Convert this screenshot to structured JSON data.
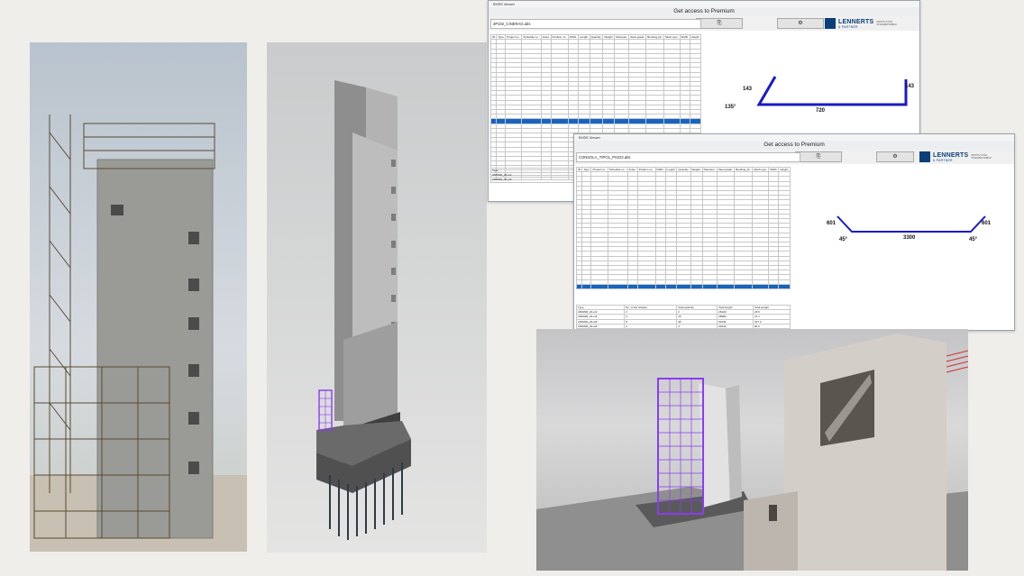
{
  "window1": {
    "title": "BVBS Viewer",
    "premium": "Get access to Premium",
    "file": "3P102_CINERAG.abs",
    "bottom_header": "Type",
    "bottom_rows": [
      "A500NR_20+12",
      "A500NR_20+16"
    ],
    "dims": {
      "left": "143",
      "angle": "135°",
      "bottom": "720",
      "right": "143"
    },
    "columns": [
      "ID",
      "Type",
      "Project no.",
      "Schedule no.",
      "Index",
      "Position no.",
      "DWG",
      "Length",
      "Quantity",
      "Weight",
      "Diameter",
      "Steel grade",
      "Bending pin",
      "Mesh type",
      "Width",
      "Height"
    ]
  },
  "window2": {
    "title": "BVBS Viewer",
    "premium": "Get access to Premium",
    "file": "CONSOLA_TIPO1_PISO3.abs",
    "dims": {
      "left": "601",
      "bottom": "3300",
      "right": "601",
      "angle_left": "45°",
      "angle_right": "45°"
    },
    "columns": [
      "ID",
      "Type",
      "Project no.",
      "Schedule no.",
      "Index",
      "Position no.",
      "DWG",
      "Length",
      "Quantity",
      "Weight",
      "Diameter",
      "Steel grade",
      "Bending pin",
      "Mesh type",
      "Width",
      "Height"
    ],
    "summary_columns": [
      "Type",
      "No. of bar shapes",
      "Total quantity",
      "Total length",
      "Total weight"
    ],
    "summary_rows": [
      [
        "A500NR_20+12",
        "2",
        "2",
        "26440",
        "23.5"
      ],
      [
        "A500NR_20+16",
        "4",
        "16",
        "28980",
        "47.1"
      ],
      [
        "A500NR_20+20",
        "8",
        "48",
        "92134",
        "227.3"
      ],
      [
        "A500NR_20+25",
        "4",
        "4",
        "20249",
        "80.2"
      ]
    ]
  },
  "logo": {
    "name": "LENNERTS",
    "sub": "& PARTNER",
    "uni": "INSTITUT FÜR STAHLBETONBAU"
  },
  "colors": {
    "selection": "#1565c0",
    "drawing_line": "#1a1ac8",
    "rebar": "#8a3cf0"
  }
}
